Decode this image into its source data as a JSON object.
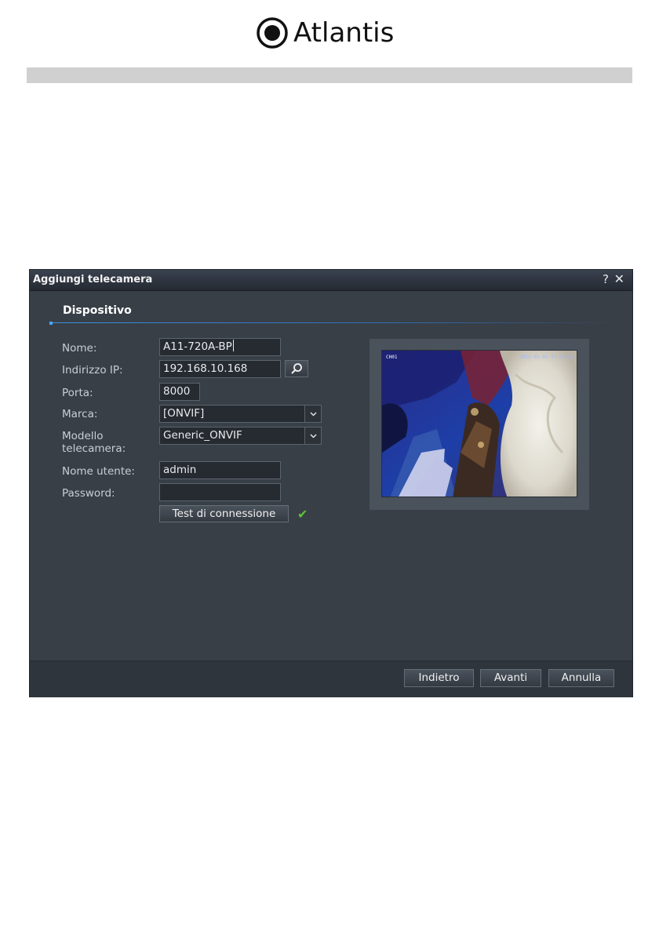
{
  "header": {
    "logo_text": "Atlantis"
  },
  "dialog": {
    "title": "Aggiungi telecamera",
    "help_symbol": "?",
    "close_symbol": "✕",
    "section_title": "Dispositivo",
    "fields": {
      "name_label": "Nome:",
      "name_value": "A11-720A-BP",
      "ip_label": "Indirizzo IP:",
      "ip_value": "192.168.10.168",
      "port_label": "Porta:",
      "port_value": "8000",
      "brand_label": "Marca:",
      "brand_value": "[ONVIF]",
      "model_label_line1": "Modello",
      "model_label_line2": "telecamera:",
      "model_value": "Generic_ONVIF",
      "username_label": "Nome utente:",
      "username_value": "admin",
      "password_label": "Password:",
      "password_value": ""
    },
    "test_button": "Test di connessione",
    "test_status": "✔",
    "preview": {
      "channel_label": "CH01",
      "timestamp": "2015-01-01 17:54:25"
    },
    "footer": {
      "back_button": "Indietro",
      "next_button": "Avanti",
      "cancel_button": "Annulla"
    }
  },
  "icons": {
    "search": "search-icon",
    "dropdown": "chevron-down-icon",
    "check": "checkmark-icon",
    "help": "help-icon",
    "close": "close-icon"
  },
  "colors": {
    "dialog_bg": "#383f47",
    "accent_line": "#3f8fe0",
    "success": "#5cc23a"
  }
}
